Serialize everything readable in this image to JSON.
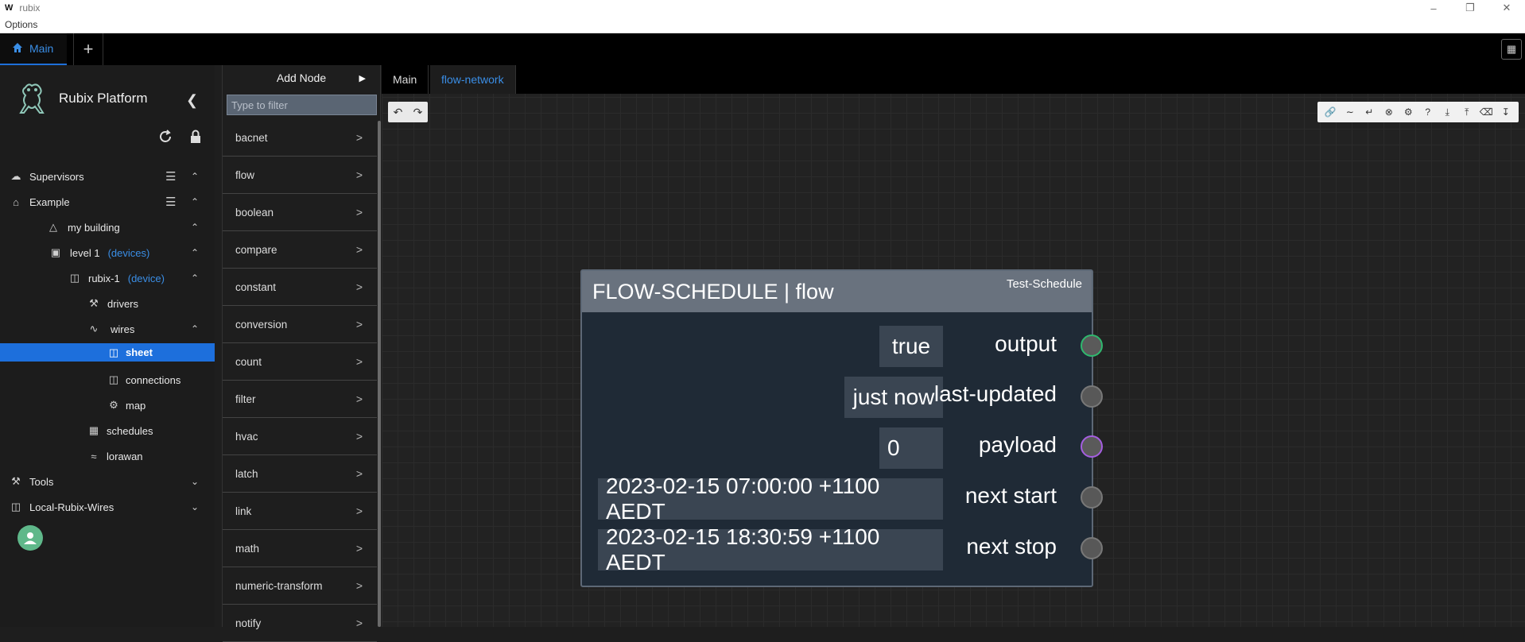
{
  "window": {
    "logo": "W",
    "title": "rubix"
  },
  "menubar": {
    "options": "Options"
  },
  "app_tabs": {
    "main": "Main"
  },
  "sidebar": {
    "brand": "Rubix Platform",
    "items": [
      {
        "label": "Supervisors"
      },
      {
        "label": "Example"
      },
      {
        "label": "my building"
      },
      {
        "label": "level 1",
        "tag": "(devices)"
      },
      {
        "label": "rubix-1",
        "tag": "(device)"
      },
      {
        "label": "drivers"
      },
      {
        "label": "wires"
      },
      {
        "label": "sheet"
      },
      {
        "label": "connections"
      },
      {
        "label": "map"
      },
      {
        "label": "schedules"
      },
      {
        "label": "lorawan"
      },
      {
        "label": "Tools"
      },
      {
        "label": "Local-Rubix-Wires"
      }
    ]
  },
  "palette": {
    "title": "Add Node",
    "filter_placeholder": "Type to filter",
    "categories": [
      "bacnet",
      "flow",
      "boolean",
      "compare",
      "constant",
      "conversion",
      "count",
      "filter",
      "hvac",
      "latch",
      "link",
      "math",
      "numeric-transform",
      "notify"
    ]
  },
  "editor_tabs": [
    "Main",
    "flow-network"
  ],
  "node": {
    "title": "FLOW-SCHEDULE | flow",
    "name": "Test-Schedule",
    "values": [
      "true",
      "just now",
      "0",
      "2023-02-15 07:00:00 +1100 AEDT",
      "2023-02-15 18:30:59 +1100 AEDT"
    ],
    "outputs": [
      "output",
      "last-updated",
      "payload",
      "next start",
      "next stop"
    ]
  },
  "colors": {
    "accent": "#1d6fdc",
    "link": "#3a8ee6",
    "port_output": "#2fb86e",
    "port_payload": "#a55ee0"
  }
}
